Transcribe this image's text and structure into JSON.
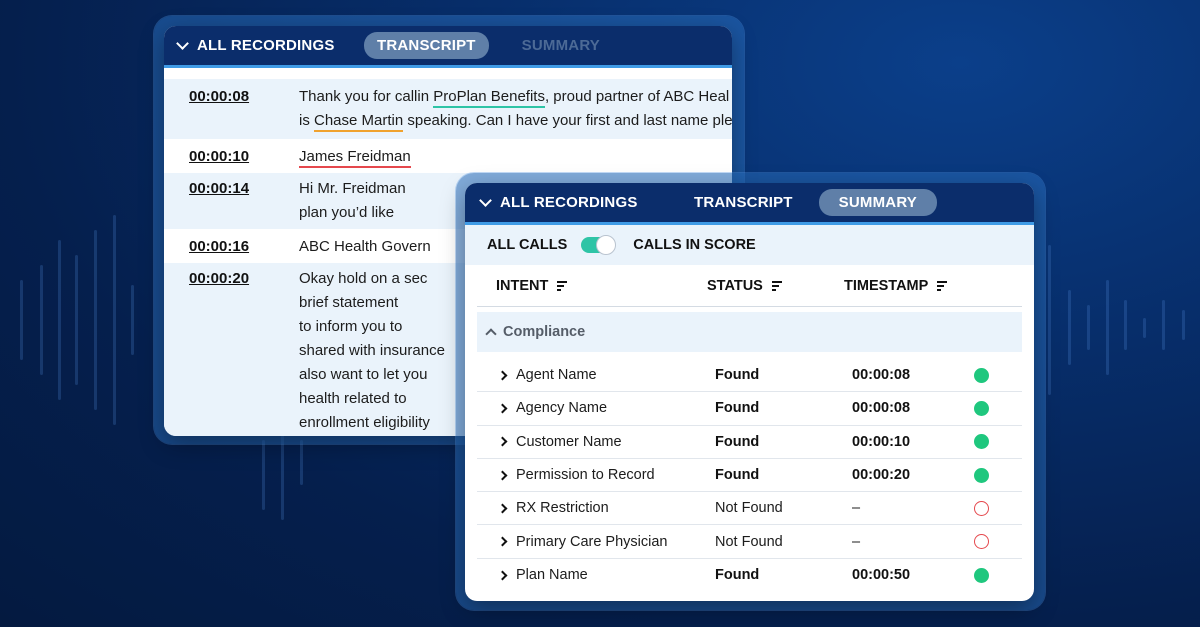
{
  "transcript_panel": {
    "header": {
      "all_recordings": "ALL RECORDINGS",
      "tab_transcript": "TRANSCRIPT",
      "tab_summary": "SUMMARY"
    },
    "rows": [
      {
        "time": "00:00:08",
        "l1_a": "Thank you for callin ",
        "l1_hl": "ProPlan Benefits",
        "l1_b": ", proud partner of ABC Heal",
        "l2_a": "is ",
        "l2_hl": "Chase Martin",
        "l2_b": " speaking. Can I have your first and last name ple"
      },
      {
        "time": "00:00:10",
        "hl": "James Freidman"
      },
      {
        "time": "00:00:14",
        "lines": [
          "Hi Mr. Freidman",
          "plan you’d like"
        ]
      },
      {
        "time": "00:00:16",
        "lines": [
          "ABC Health Govern"
        ]
      },
      {
        "time": "00:00:20",
        "lines": [
          "Okay hold on a sec",
          "brief statement",
          "to inform you to",
          "shared with insurance",
          "also want to let you",
          "health related to",
          "enrollment eligibility"
        ]
      }
    ]
  },
  "summary_panel": {
    "header": {
      "all_recordings": "ALL RECORDINGS",
      "tab_transcript": "TRANSCRIPT",
      "tab_summary": "SUMMARY"
    },
    "filters": {
      "all_calls": "ALL CALLS",
      "calls_in_score": "CALLS IN SCORE"
    },
    "columns": {
      "intent": "INTENT",
      "status": "STATUS",
      "timestamp": "TIMESTAMP"
    },
    "group": "Compliance",
    "rows": [
      {
        "intent": "Agent Name",
        "status": "Found",
        "timestamp": "00:00:08"
      },
      {
        "intent": "Agency Name",
        "status": "Found",
        "timestamp": "00:00:08"
      },
      {
        "intent": "Customer Name",
        "status": "Found",
        "timestamp": "00:00:10"
      },
      {
        "intent": "Permission to Record",
        "status": "Found",
        "timestamp": "00:00:20"
      },
      {
        "intent": "RX Restriction",
        "status": "Not Found",
        "timestamp": "–"
      },
      {
        "intent": "Primary Care Physician",
        "status": "Not Found",
        "timestamp": "–"
      },
      {
        "intent": "Plan Name",
        "status": "Found",
        "timestamp": "00:00:50"
      }
    ]
  },
  "colors": {
    "found_dot": "#1fc77e",
    "missing_dot": "#e5484d",
    "header_bg": "#0b2d6b",
    "toggle_on": "#2ec4a6"
  }
}
